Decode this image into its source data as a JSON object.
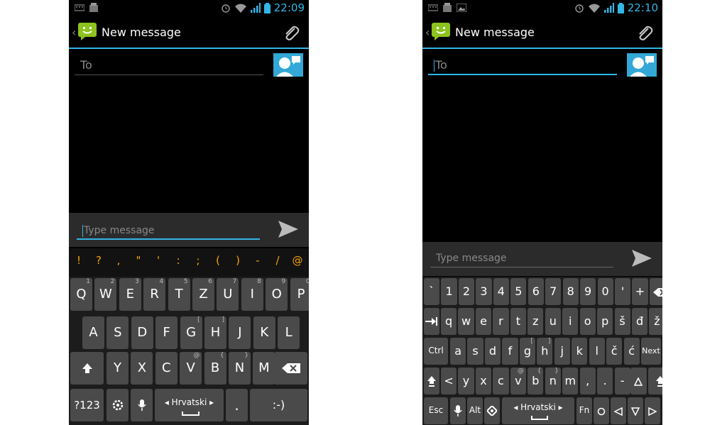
{
  "left": {
    "status_time": "22:09",
    "title": "New message",
    "to_placeholder": "To",
    "message_placeholder": "Type message",
    "symbols": [
      "!",
      "?",
      ",",
      "\"",
      "'",
      ":",
      ";",
      "(",
      ")",
      "-",
      "/",
      "@"
    ],
    "row1": [
      {
        "k": "Q",
        "h": "1"
      },
      {
        "k": "W",
        "h": "2"
      },
      {
        "k": "E",
        "h": "3"
      },
      {
        "k": "R",
        "h": "4"
      },
      {
        "k": "T",
        "h": "5"
      },
      {
        "k": "Z",
        "h": "6"
      },
      {
        "k": "U",
        "h": "7"
      },
      {
        "k": "I",
        "h": "8"
      },
      {
        "k": "O",
        "h": "9"
      },
      {
        "k": "P",
        "h": "0"
      }
    ],
    "row2": [
      {
        "k": "A",
        "h": ""
      },
      {
        "k": "S",
        "h": ""
      },
      {
        "k": "D",
        "h": ""
      },
      {
        "k": "F",
        "h": ""
      },
      {
        "k": "G",
        "h": "["
      },
      {
        "k": "H",
        "h": "]"
      },
      {
        "k": "J",
        "h": ""
      },
      {
        "k": "K",
        "h": ""
      },
      {
        "k": "L",
        "h": ""
      }
    ],
    "row3": [
      {
        "k": "Y",
        "h": ""
      },
      {
        "k": "X",
        "h": ""
      },
      {
        "k": "C",
        "h": ""
      },
      {
        "k": "V",
        "h": "@"
      },
      {
        "k": "B",
        "h": "{"
      },
      {
        "k": "N",
        "h": "}"
      },
      {
        "k": "M",
        "h": ""
      }
    ],
    "mode_key": "?123",
    "language_key": "◂ Hrvatski ▸",
    "period_key": ".",
    "smiley_key": ":-)"
  },
  "right": {
    "status_time": "22:10",
    "title": "New message",
    "to_placeholder": "To",
    "message_placeholder": "Type message",
    "row1": [
      "`",
      "1",
      "2",
      "3",
      "4",
      "5",
      "6",
      "7",
      "8",
      "9",
      "0",
      "'",
      "+"
    ],
    "row2": [
      "q",
      "w",
      "e",
      "r",
      "t",
      "z",
      "u",
      "i",
      "o",
      "p",
      "š",
      "đ",
      "ž"
    ],
    "row2_hints": [
      "",
      "",
      "",
      "",
      "",
      "",
      "",
      "",
      "",
      "",
      "",
      "",
      ""
    ],
    "row3": [
      "a",
      "s",
      "d",
      "f",
      "g",
      "h",
      "j",
      "k",
      "l",
      "č",
      "ć"
    ],
    "row3_hints": [
      "",
      "",
      "",
      "",
      "[",
      "]",
      "",
      "",
      "",
      "",
      ""
    ],
    "row4": [
      "<",
      "y",
      "x",
      "c",
      "v",
      "b",
      "n",
      "m",
      ",",
      ".",
      "-"
    ],
    "row4_hints": [
      "",
      "",
      "",
      "",
      "@",
      "{",
      "}",
      "",
      "",
      "",
      ""
    ],
    "ctrl_key": "Ctrl",
    "next_key": "Next",
    "esc_key": "Esc",
    "alt_key": "Alt",
    "language_key": "◂ Hrvatski ▸",
    "fn_key": "Fn"
  }
}
